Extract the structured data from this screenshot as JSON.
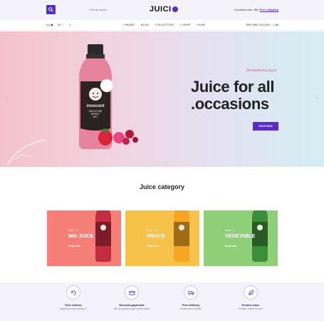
{
  "header": {
    "search_placeholder": "Find our search",
    "logo": "JUICI",
    "order_text": "Invorders over: $50",
    "free_shipping": "Free shipping"
  },
  "nav": {
    "cart_count": "(0)",
    "wishlist_count": "(0)",
    "items": [
      "PAGES",
      "BLOG",
      "COLLECTION",
      "SHOP",
      "HOME"
    ],
    "phone": "7890 456 123 (234+ : Call"
  },
  "hero": {
    "tag": "Strawberry juice",
    "title_line1": "Juice for all",
    "title_line2": ".occasions",
    "button": "SHOP NOW",
    "bottle_brand": "innocent",
    "bottle_text": [
      "SMOOTHIE",
      "BERRY",
      "SET"
    ]
  },
  "category": {
    "title": "Juice category",
    "cards": [
      {
        "small": "Mary +9",
        "name": "MIX JUICE",
        "shop": "Shop now",
        "bg": "#f57f76",
        "bottle": "#c42c3f"
      },
      {
        "small": "Items +10",
        "name": "FRUITS",
        "shop": "Shop now",
        "bg": "#f7c24a",
        "bottle": "#f5a623"
      },
      {
        "small": "Items +9",
        "name": "VEGETABLE",
        "shop": "Shop now",
        "bg": "#8fcf78",
        "bottle": "#3c8f3a"
      }
    ]
  },
  "features": [
    {
      "title": "Free returns",
      "desc": "days free return policy !7"
    },
    {
      "title": "Secured payments",
      "desc": "We accept all major credit cards"
    },
    {
      "title": "Free delivery",
      "desc": "Orders from all item"
    },
    {
      "title": "Fresher juice",
      "desc": "Fresher better for you"
    }
  ],
  "colors": {
    "accent": "#5b2cc9"
  }
}
